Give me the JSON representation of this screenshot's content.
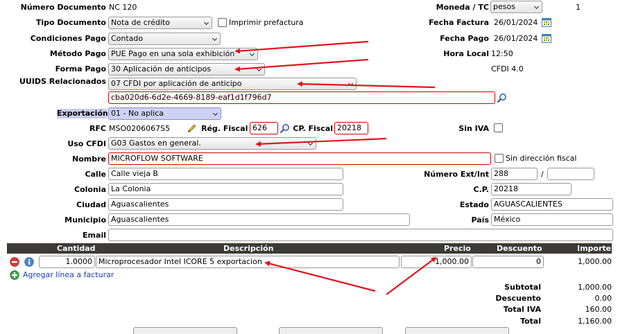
{
  "header": {
    "numero_label": "Número Documento",
    "numero_value": "NC 120",
    "moneda_label": "Moneda / TC",
    "moneda_value": "pesos",
    "tc_value": "1",
    "tipo_label": "Tipo Documento",
    "tipo_value": "Nota de crédito",
    "imprimir_label": "Imprimir prefactura",
    "fecha_factura_label": "Fecha Factura",
    "fecha_factura_value": "26/01/2024",
    "condiciones_label": "Condiciones Pago",
    "condiciones_value": "Contado",
    "fecha_pago_label": "Fecha Pago",
    "fecha_pago_value": "26/01/2024",
    "metodo_label": "Método Pago",
    "metodo_value": "PUE Pago en una sola exhibición",
    "hora_label": "Hora Local",
    "hora_value": "12:50",
    "forma_label": "Forma Pago",
    "forma_value": "30 Aplicación de anticipos",
    "cfdi_version": "CFDI 4.0",
    "uuids_label": "UUIDS Relacionados",
    "uuids_value": "07 CFDI por aplicación de anticipo",
    "uuid_value": "cba020d6-6d2e-4669-8189-eaf1d1f796d7",
    "exportacion_label": "Exportación",
    "exportacion_value": "01 - No aplica"
  },
  "cliente": {
    "rfc_label": "RFC",
    "rfc_value": "MSO0206067S5",
    "reg_fiscal_label": "Rég. Fiscal",
    "reg_fiscal_value": "626",
    "cp_fiscal_label": "CP. Fiscal",
    "cp_fiscal_value": "20218",
    "sin_iva_label": "Sin IVA",
    "uso_label": "Uso CFDI",
    "uso_value": "G03 Gastos en general.",
    "nombre_label": "Nombre",
    "nombre_value": "MICROFLOW SOFTWARE",
    "sin_direccion_label": "Sin dirección fiscal",
    "calle_label": "Calle",
    "calle_value": "Calle vieja B",
    "num_label": "Número Ext/Int",
    "num_ext_value": "288",
    "num_sep": "/",
    "num_int_value": "",
    "colonia_label": "Colonia",
    "colonia_value": "La Colonia",
    "cp_label": "C.P.",
    "cp_value": "20218",
    "ciudad_label": "Ciudad",
    "ciudad_value": "Aguascalientes",
    "estado_label": "Estado",
    "estado_value": "AGUASCALIENTES",
    "municipio_label": "Municipio",
    "municipio_value": "Aguascalientes",
    "pais_label": "País",
    "pais_value": "México",
    "email_label": "Email",
    "email_value": ""
  },
  "table": {
    "columns": [
      "Cantidad",
      "Descripción",
      "Precio",
      "Descuento",
      "Importe"
    ],
    "rows": [
      {
        "cantidad": "1.0000",
        "descripcion": "Microprocesador Intel ICORE 5 exportacion",
        "precio": "1,000.00",
        "descuento": "0",
        "importe": "1,000.00"
      }
    ],
    "add_line_label": "Agregar línea a facturar"
  },
  "totals": {
    "subtotal_label": "Subtotal",
    "subtotal_value": "1,000.00",
    "descuento_label": "Descuento",
    "descuento_value": "0.00",
    "iva_label": "Total IVA",
    "iva_value": "160.00",
    "total_label": "Total",
    "total_value": "1,160.00"
  },
  "icons": {
    "calendar": "calendar-icon",
    "search": "magnifier-icon",
    "pencil": "pencil-icon",
    "remove": "remove-row-icon",
    "info": "info-icon",
    "add": "add-line-icon"
  },
  "colors": {
    "annotation": "#e3141b",
    "required_border": "#d40000",
    "table_header": "#3e3a36",
    "highlight": "#c9cdf0"
  }
}
